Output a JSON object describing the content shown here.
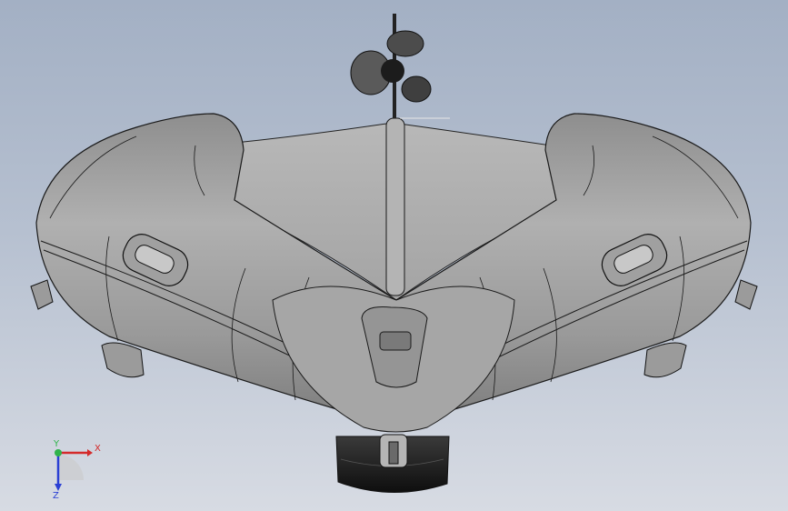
{
  "viewport": {
    "background_top": "#a3b0c4",
    "background_bottom": "#d7dbe3",
    "model_color": "#9c9c9c",
    "edge_color": "#1a1a1a"
  },
  "triad": {
    "x_label": "X",
    "y_label": "Y",
    "z_label": "Z",
    "x_color": "#d42a2a",
    "y_color": "#2fb34a",
    "z_color": "#2a3fd4"
  }
}
